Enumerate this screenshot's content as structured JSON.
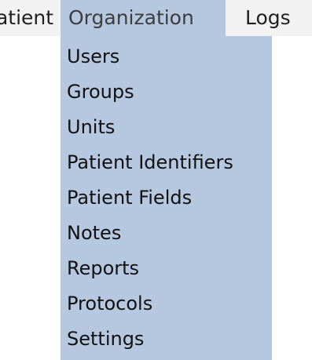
{
  "menubar": {
    "items": [
      {
        "label": "Patient"
      },
      {
        "label": "Organization"
      },
      {
        "label": "Logs"
      }
    ]
  },
  "dropdown": {
    "items": [
      {
        "label": "Users"
      },
      {
        "label": "Groups"
      },
      {
        "label": "Units"
      },
      {
        "label": "Patient Identifiers"
      },
      {
        "label": "Patient Fields"
      },
      {
        "label": "Notes"
      },
      {
        "label": "Reports"
      },
      {
        "label": "Protocols"
      },
      {
        "label": "Settings"
      }
    ]
  },
  "colors": {
    "menubar_bg": "#f2f2f2",
    "highlight_bg": "#b6c7e0",
    "text": "#111111"
  }
}
